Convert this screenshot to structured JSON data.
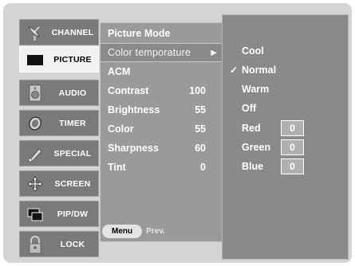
{
  "tabs": [
    {
      "label": "CHANNEL",
      "icon": "satellite-dish-icon",
      "active": false
    },
    {
      "label": "PICTURE",
      "icon": "tv-screen-icon",
      "active": true
    },
    {
      "label": "AUDIO",
      "icon": "speaker-icon",
      "active": false
    },
    {
      "label": "TIMER",
      "icon": "clock-icon",
      "active": false
    },
    {
      "label": "SPECIAL",
      "icon": "pencil-icon",
      "active": false
    },
    {
      "label": "SCREEN",
      "icon": "move-arrows-icon",
      "active": false
    },
    {
      "label": "PIP/DW",
      "icon": "pip-windows-icon",
      "active": false
    },
    {
      "label": "LOCK",
      "icon": "padlock-icon",
      "active": false
    }
  ],
  "menu": {
    "items": [
      {
        "label": "Picture Mode",
        "value": ""
      },
      {
        "label": "Color temporature",
        "value": "",
        "arrow": "▶",
        "selected": true
      },
      {
        "label": "ACM",
        "value": ""
      },
      {
        "label": "Contrast",
        "value": "100"
      },
      {
        "label": "Brightness",
        "value": "55"
      },
      {
        "label": "Color",
        "value": "55"
      },
      {
        "label": "Sharpness",
        "value": "60"
      },
      {
        "label": "Tint",
        "value": "0"
      }
    ],
    "hint": {
      "button": "Menu",
      "text": "Prev."
    }
  },
  "submenu": {
    "items": [
      {
        "label": "Cool",
        "checked": false
      },
      {
        "label": "Normal",
        "checked": true,
        "check_mark": "✓"
      },
      {
        "label": "Warm",
        "checked": false
      },
      {
        "label": "Off",
        "checked": false
      },
      {
        "label": "Red",
        "value": "0"
      },
      {
        "label": "Green",
        "value": "0"
      },
      {
        "label": "Blue",
        "value": "0"
      }
    ]
  },
  "colors": {
    "osd_bg": "#d4d4d4",
    "menu_bg": "#9a9a9a",
    "submenu_bg": "#8a8a8a",
    "tab_bg": "#7a7a7a",
    "tab_active_bg": "#f2f2f2"
  }
}
